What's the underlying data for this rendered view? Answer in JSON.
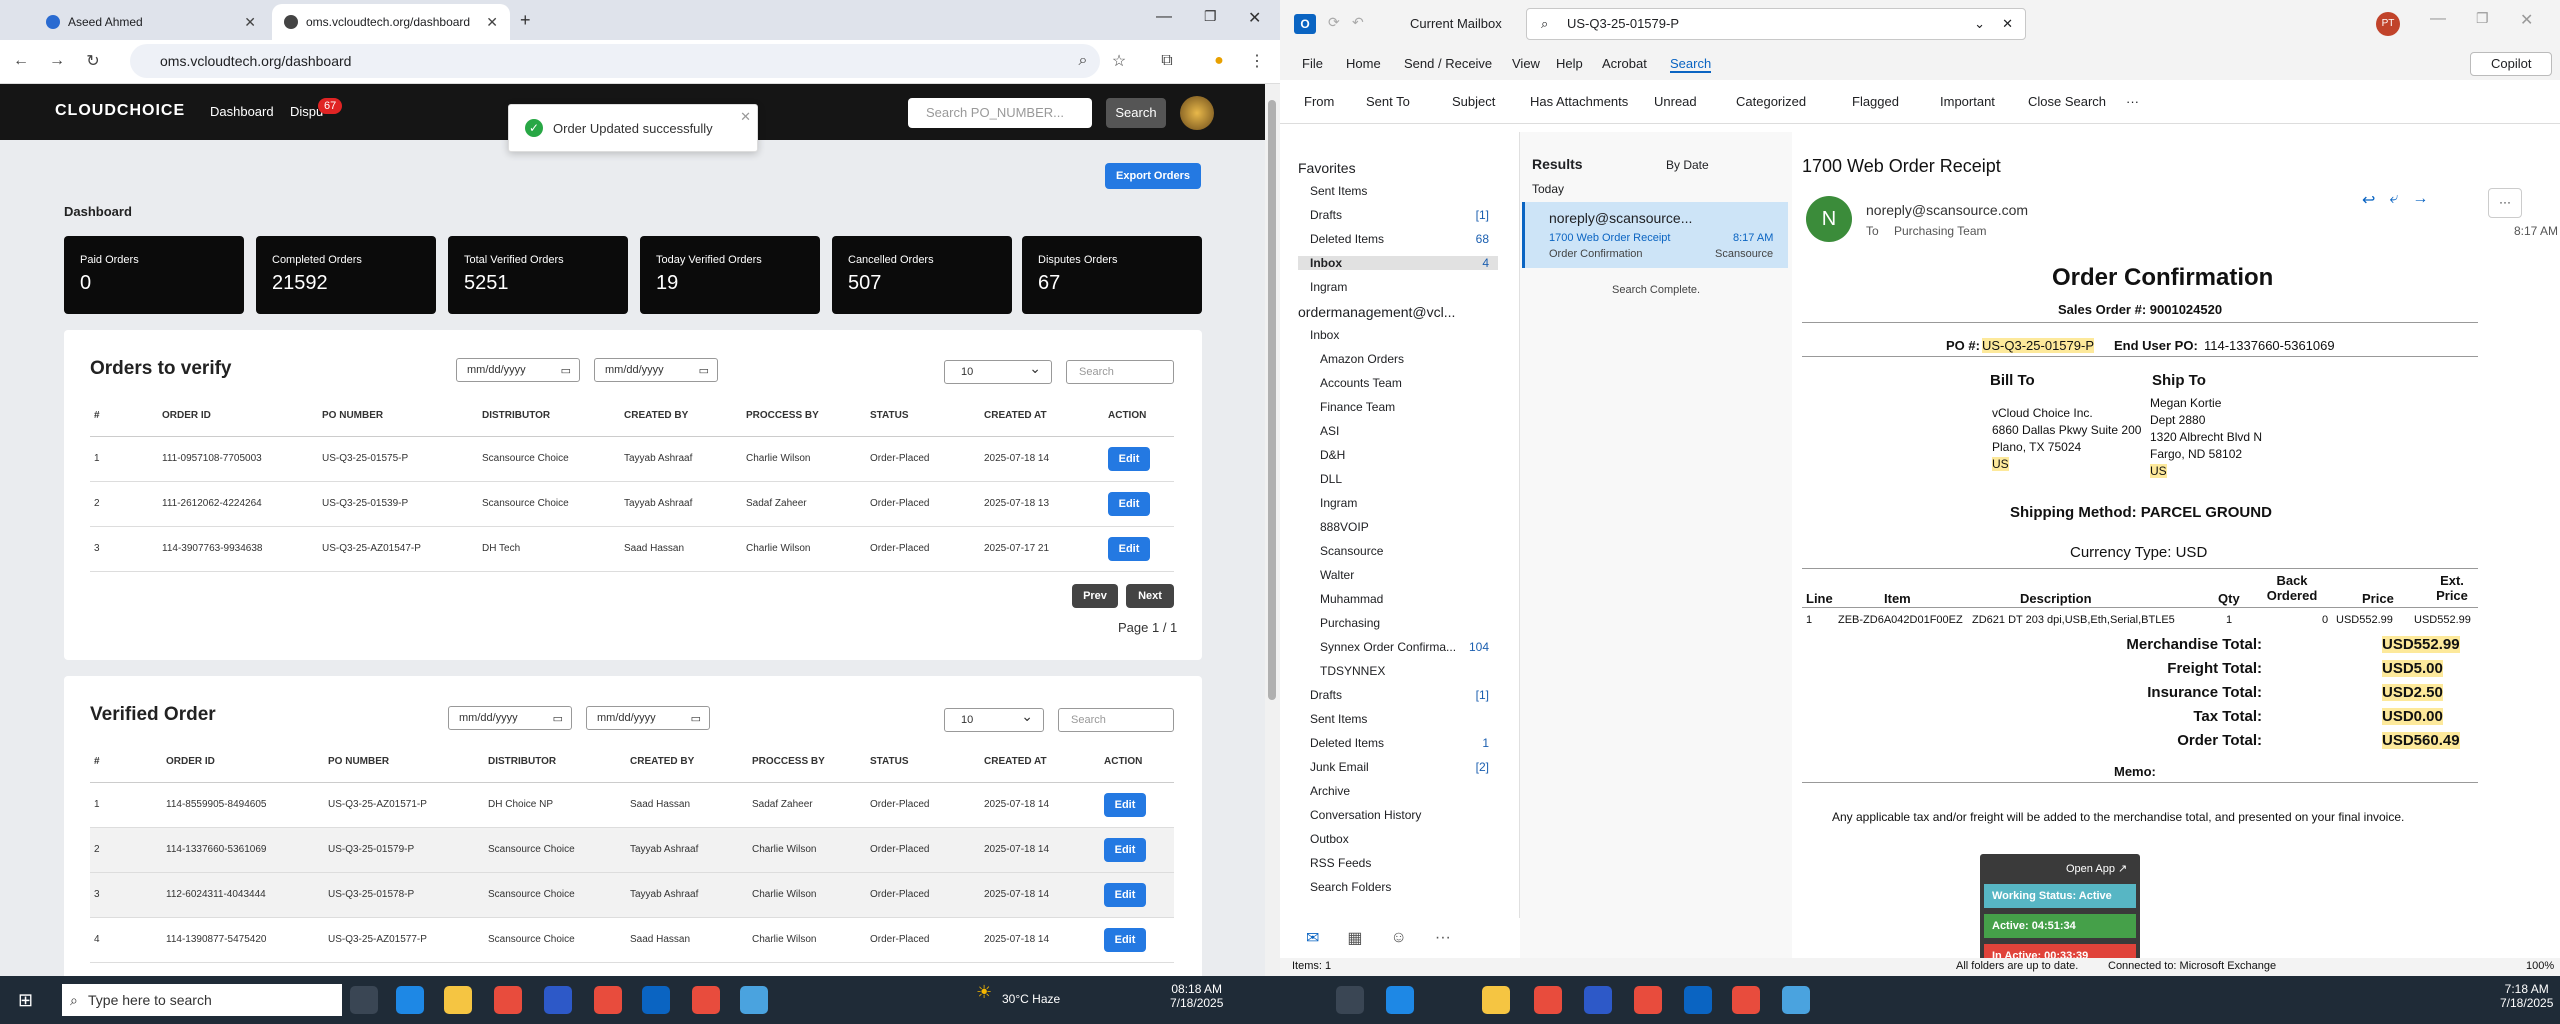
{
  "browser": {
    "tabs": [
      "Aseed Ahmed",
      "oms.vcloudtech.org/dashboard"
    ],
    "url": "oms.vcloudtech.org/dashboard"
  },
  "nav": {
    "logo": "CLOUDCHOICE",
    "links": [
      "Dashboard",
      "Dispu"
    ],
    "badge": "67",
    "search_placeholder": "Search PO_NUMBER...",
    "search_button": "Search"
  },
  "toast": "Order Updated successfully",
  "export": "Export Orders",
  "dashboard_title": "Dashboard",
  "stats": [
    {
      "label": "Paid Orders",
      "value": "0"
    },
    {
      "label": "Completed Orders",
      "value": "21592"
    },
    {
      "label": "Total Verified Orders",
      "value": "5251"
    },
    {
      "label": "Today Verified Orders",
      "value": "19"
    },
    {
      "label": "Cancelled Orders",
      "value": "507"
    },
    {
      "label": "Disputes Orders",
      "value": "67"
    }
  ],
  "verify": {
    "title": "Orders to verify",
    "date_placeholder": "mm/dd/yyyy",
    "page_size": "10",
    "search": "Search",
    "headers": [
      "#",
      "ORDER ID",
      "PO NUMBER",
      "DISTRIBUTOR",
      "CREATED BY",
      "PROCCESS BY",
      "STATUS",
      "CREATED AT",
      "ACTION"
    ],
    "rows": [
      [
        "1",
        "111-0957108-7705003",
        "US-Q3-25-01575-P",
        "Scansource Choice",
        "Tayyab Ashraaf",
        "Charlie Wilson",
        "Order-Placed",
        "2025-07-18 14",
        "Edit"
      ],
      [
        "2",
        "111-2612062-4224264",
        "US-Q3-25-01539-P",
        "Scansource Choice",
        "Tayyab Ashraaf",
        "Sadaf Zaheer",
        "Order-Placed",
        "2025-07-18 13",
        "Edit"
      ],
      [
        "3",
        "114-3907763-9934638",
        "US-Q3-25-AZ01547-P",
        "DH Tech",
        "Saad Hassan",
        "Charlie Wilson",
        "Order-Placed",
        "2025-07-17 21",
        "Edit"
      ]
    ],
    "prev": "Prev",
    "next": "Next",
    "page": "Page 1 / 1"
  },
  "verified": {
    "title": "Verified Order",
    "date_placeholder": "mm/dd/yyyy",
    "page_size": "10",
    "search": "Search",
    "headers": [
      "#",
      "ORDER ID",
      "PO NUMBER",
      "DISTRIBUTOR",
      "CREATED BY",
      "PROCCESS BY",
      "STATUS",
      "CREATED AT",
      "ACTION"
    ],
    "rows": [
      [
        "1",
        "114-8559905-8494605",
        "US-Q3-25-AZ01571-P",
        "DH Choice NP",
        "Saad Hassan",
        "Sadaf Zaheer",
        "Order-Placed",
        "2025-07-18 14",
        "Edit"
      ],
      [
        "2",
        "114-1337660-5361069",
        "US-Q3-25-01579-P",
        "Scansource Choice",
        "Tayyab Ashraaf",
        "Charlie Wilson",
        "Order-Placed",
        "2025-07-18 14",
        "Edit"
      ],
      [
        "3",
        "112-6024311-4043444",
        "US-Q3-25-01578-P",
        "Scansource Choice",
        "Tayyab Ashraaf",
        "Charlie Wilson",
        "Order-Placed",
        "2025-07-18 14",
        "Edit"
      ],
      [
        "4",
        "114-1390877-5475420",
        "US-Q3-25-AZ01577-P",
        "Scansource Choice",
        "Saad Hassan",
        "Charlie Wilson",
        "Order-Placed",
        "2025-07-18 14",
        "Edit"
      ]
    ]
  },
  "outlook": {
    "mailbox": "Current Mailbox",
    "search": "US-Q3-25-01579-P",
    "initials": "PT",
    "copilot": "Copilot",
    "menu": [
      "File",
      "Home",
      "Send / Receive",
      "View",
      "Help",
      "Acrobat",
      "Search"
    ],
    "ribbon": [
      "From",
      "Sent To",
      "Subject",
      "Has Attachments",
      "Unread",
      "Categorized",
      "Flagged",
      "Important",
      "Close Search",
      "···"
    ],
    "folders": [
      {
        "name": "Favorites",
        "count": ""
      },
      {
        "name": "Sent Items",
        "count": ""
      },
      {
        "name": "Drafts",
        "count": "[1]"
      },
      {
        "name": "Deleted Items",
        "count": "68"
      },
      {
        "name": "Inbox",
        "count": "4"
      },
      {
        "name": "Ingram",
        "count": ""
      },
      {
        "name": "ordermanagement@vcl...",
        "count": ""
      },
      {
        "name": "Inbox",
        "count": ""
      },
      {
        "name": "Amazon Orders",
        "count": ""
      },
      {
        "name": "Accounts Team",
        "count": ""
      },
      {
        "name": "Finance Team",
        "count": ""
      },
      {
        "name": "ASI",
        "count": ""
      },
      {
        "name": "D&H",
        "count": ""
      },
      {
        "name": "DLL",
        "count": ""
      },
      {
        "name": "Ingram",
        "count": ""
      },
      {
        "name": "888VOIP",
        "count": ""
      },
      {
        "name": "Scansource",
        "count": ""
      },
      {
        "name": "Walter",
        "count": ""
      },
      {
        "name": "Muhammad",
        "count": ""
      },
      {
        "name": "Purchasing",
        "count": ""
      },
      {
        "name": "Synnex Order Confirma...",
        "count": "104"
      },
      {
        "name": "TDSYNNEX",
        "count": ""
      },
      {
        "name": "Drafts",
        "count": "[1]"
      },
      {
        "name": "Sent Items",
        "count": ""
      },
      {
        "name": "Deleted Items",
        "count": "1"
      },
      {
        "name": "Junk Email",
        "count": "[2]"
      },
      {
        "name": "Archive",
        "count": ""
      },
      {
        "name": "Conversation History",
        "count": ""
      },
      {
        "name": "Outbox",
        "count": ""
      },
      {
        "name": "RSS Feeds",
        "count": ""
      },
      {
        "name": "Search Folders",
        "count": ""
      }
    ],
    "results": {
      "title": "Results",
      "sort": "By Date",
      "group": "Today",
      "sender": "noreply@scansource...",
      "subject": "1700 Web Order Receipt",
      "time": "8:17 AM",
      "category": "Order Confirmation",
      "tag": "Scansource",
      "done": "Search Complete."
    },
    "mail": {
      "subject": "1700 Web Order Receipt",
      "from": "noreply@scansource.com",
      "to_label": "To",
      "to": "Purchasing Team",
      "time": "8:17 AM",
      "avatar": "N",
      "heading": "Order Confirmation",
      "sales_order": "Sales Order #:  9001024520",
      "po_label": "PO #:",
      "po": "US-Q3-25-01579-P",
      "enduser_label": "End User PO:",
      "enduser": "114-1337660-5361069",
      "bill_to": "Bill To",
      "bill": [
        "vCloud Choice Inc.",
        "6860 Dallas Pkwy Suite 200",
        "Plano, TX 75024",
        "US"
      ],
      "ship_to": "Ship To",
      "ship": [
        "Megan Kortie",
        "Dept 2880",
        "1320 Albrecht Blvd N",
        "Fargo, ND 58102",
        "US"
      ],
      "shipping": "Shipping Method: PARCEL GROUND",
      "currency": "Currency Type: USD",
      "cols": [
        "Line",
        "Item",
        "Description",
        "Qty",
        "Back Ordered",
        "Price",
        "Ext. Price"
      ],
      "line": [
        "1",
        "ZEB-ZD6A042D01F00EZ",
        "ZD621 DT 203 dpi,USB,Eth,Serial,BTLE5",
        "1",
        "0",
        "USD552.99",
        "USD552.99"
      ],
      "totals": [
        [
          "Merchandise Total:",
          "USD552.99"
        ],
        [
          "Freight Total:",
          "USD5.00"
        ],
        [
          "Insurance Total:",
          "USD2.50"
        ],
        [
          "Tax Total:",
          "USD0.00"
        ],
        [
          "Order Total:",
          "USD560.49"
        ]
      ],
      "memo": "Memo:",
      "footer": "Any applicable tax and/or freight will be added to the merchandise total, and presented on your final invoice."
    },
    "widget": {
      "open": "Open App ↗",
      "status": "Working Status: Active",
      "active": "Active: 04:51:34",
      "inactive": "In Active: 00:33:39"
    },
    "statusbar": {
      "items": "Items: 1",
      "sync": "All folders are up to date.",
      "conn": "Connected to: Microsoft Exchange",
      "zoom": "100%"
    }
  },
  "taskbar": {
    "search": "Type here to search",
    "weather": "30°C  Haze",
    "time1": "08:18 AM",
    "date1": "7/18/2025",
    "time2": "7:18 AM",
    "date2": "7/18/2025"
  },
  "colors": {
    "accent": "#2479e2",
    "dark": "#0b0b0b",
    "highlight": "#fde99b"
  }
}
